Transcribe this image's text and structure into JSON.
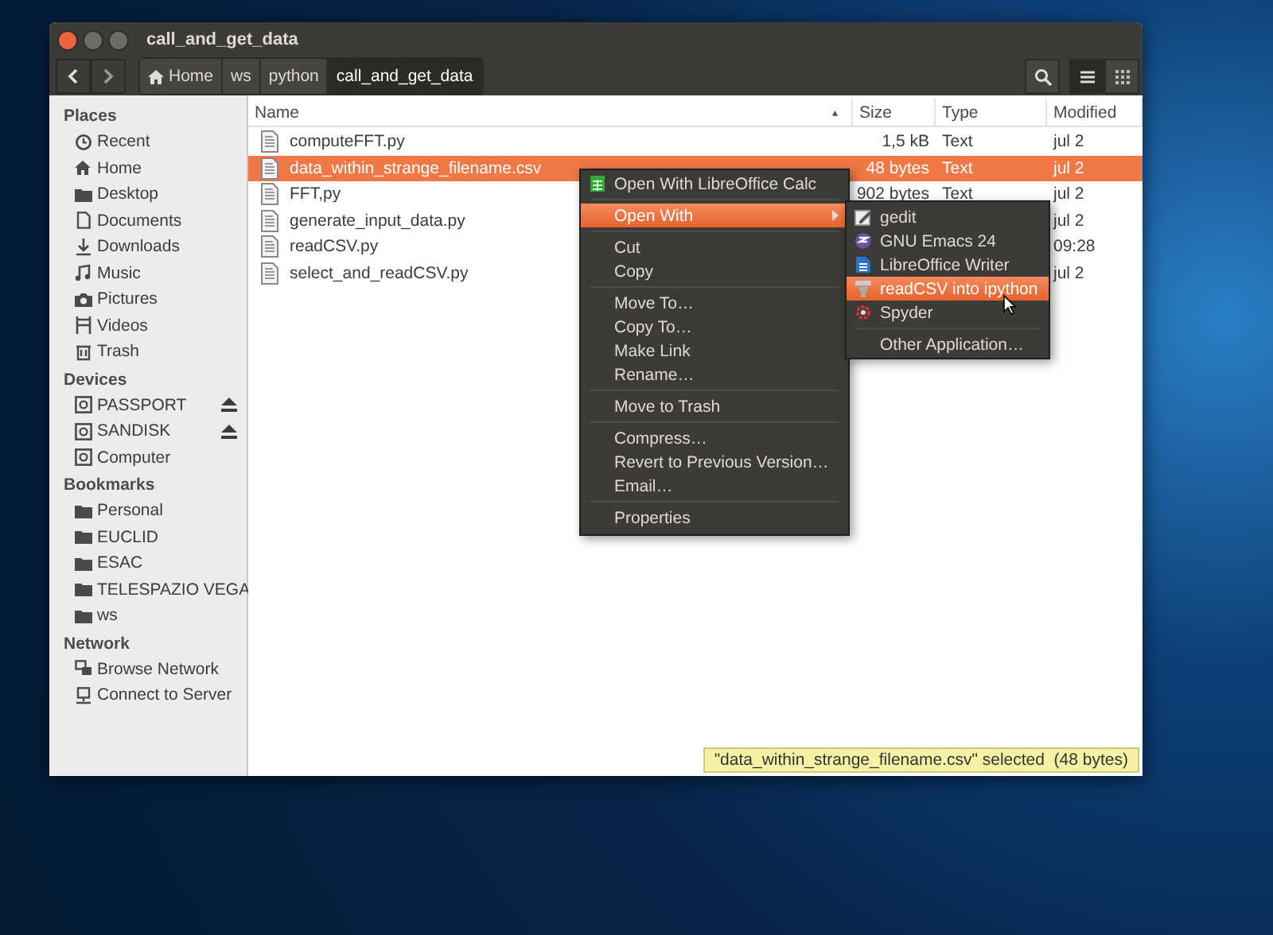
{
  "window": {
    "title": "call_and_get_data"
  },
  "toolbar": {
    "path": [
      {
        "label": "Home",
        "kind": "home",
        "selected": false
      },
      {
        "label": "ws",
        "kind": "folder",
        "selected": false
      },
      {
        "label": "python",
        "kind": "folder",
        "selected": false
      },
      {
        "label": "call_and_get_data",
        "kind": "folder",
        "selected": true
      }
    ],
    "view_buttons": [
      {
        "kind": "search",
        "selected": false
      },
      {
        "kind": "list",
        "selected": true
      },
      {
        "kind": "grid",
        "selected": false
      }
    ]
  },
  "sidebar": {
    "sections": [
      {
        "title": "Places",
        "items": [
          {
            "label": "Recent",
            "ejectable": false
          },
          {
            "label": "Home",
            "ejectable": false
          },
          {
            "label": "Desktop",
            "ejectable": false
          },
          {
            "label": "Documents",
            "ejectable": false
          },
          {
            "label": "Downloads",
            "ejectable": false
          },
          {
            "label": "Music",
            "ejectable": false
          },
          {
            "label": "Pictures",
            "ejectable": false
          },
          {
            "label": "Videos",
            "ejectable": false
          },
          {
            "label": "Trash",
            "ejectable": false
          }
        ]
      },
      {
        "title": "Devices",
        "items": [
          {
            "label": "PASSPORT",
            "ejectable": true
          },
          {
            "label": "SANDISK",
            "ejectable": true
          },
          {
            "label": "Computer",
            "ejectable": false
          }
        ]
      },
      {
        "title": "Bookmarks",
        "items": [
          {
            "label": "Personal",
            "ejectable": false
          },
          {
            "label": "EUCLID",
            "ejectable": false
          },
          {
            "label": "ESAC",
            "ejectable": false
          },
          {
            "label": "TELESPAZIO VEGA",
            "ejectable": false
          },
          {
            "label": "ws",
            "ejectable": false
          }
        ]
      },
      {
        "title": "Network",
        "items": [
          {
            "label": "Browse Network",
            "ejectable": false
          },
          {
            "label": "Connect to Server",
            "ejectable": false
          }
        ]
      }
    ]
  },
  "table": {
    "columns": [
      {
        "label": "Name",
        "sort": "▴"
      },
      {
        "label": "Size"
      },
      {
        "label": "Type"
      },
      {
        "label": "Modified"
      }
    ],
    "rows": [
      {
        "name": "computeFFT.py",
        "size": "1,5 kB",
        "type": "Text",
        "modified": "jul 2",
        "selected": false
      },
      {
        "name": "data_within_strange_filename.csv",
        "size": "48 bytes",
        "type": "Text",
        "modified": "jul 2",
        "selected": true
      },
      {
        "name": "FFT,py",
        "size": "902 bytes",
        "type": "Text",
        "modified": "jul 2",
        "selected": false
      },
      {
        "name": "generate_input_data.py",
        "size": "",
        "type": "",
        "modified": "jul 2",
        "selected": false
      },
      {
        "name": "readCSV.py",
        "size": "",
        "type": "",
        "modified": "09:28",
        "selected": false
      },
      {
        "name": "select_and_readCSV.py",
        "size": "",
        "type": "",
        "modified": "jul 2",
        "selected": false
      }
    ]
  },
  "context_menu": {
    "items": [
      {
        "kind": "item",
        "label": "Open With LibreOffice Calc",
        "selected": false,
        "submenu": false
      },
      {
        "kind": "separator"
      },
      {
        "kind": "item",
        "label": "Open With",
        "selected": true,
        "submenu": true
      },
      {
        "kind": "separator"
      },
      {
        "kind": "item",
        "label": "Cut",
        "selected": false,
        "submenu": false
      },
      {
        "kind": "item",
        "label": "Copy",
        "selected": false,
        "submenu": false
      },
      {
        "kind": "separator"
      },
      {
        "kind": "item",
        "label": "Move To…",
        "selected": false,
        "submenu": false
      },
      {
        "kind": "item",
        "label": "Copy To…",
        "selected": false,
        "submenu": false
      },
      {
        "kind": "item",
        "label": "Make Link",
        "selected": false,
        "submenu": false
      },
      {
        "kind": "item",
        "label": "Rename…",
        "selected": false,
        "submenu": false
      },
      {
        "kind": "separator"
      },
      {
        "kind": "item",
        "label": "Move to Trash",
        "selected": false,
        "submenu": false
      },
      {
        "kind": "separator"
      },
      {
        "kind": "item",
        "label": "Compress…",
        "selected": false,
        "submenu": false
      },
      {
        "kind": "item",
        "label": "Revert to Previous Version…",
        "selected": false,
        "submenu": false
      },
      {
        "kind": "item",
        "label": "Email…",
        "selected": false,
        "submenu": false
      },
      {
        "kind": "separator"
      },
      {
        "kind": "item",
        "label": "Properties",
        "selected": false,
        "submenu": false
      }
    ]
  },
  "submenu": {
    "items": [
      {
        "kind": "item",
        "label": "gedit",
        "selected": false
      },
      {
        "kind": "item",
        "label": "GNU Emacs 24",
        "selected": false
      },
      {
        "kind": "item",
        "label": "LibreOffice Writer",
        "selected": false
      },
      {
        "kind": "item",
        "label": "readCSV into ipython",
        "selected": true
      },
      {
        "kind": "item",
        "label": "Spyder",
        "selected": false
      },
      {
        "kind": "separator"
      },
      {
        "kind": "item",
        "label": "Other Application…",
        "selected": false
      }
    ]
  },
  "status_bar": {
    "text": "\"data_within_strange_filename.csv\" selected  (48 bytes)"
  }
}
